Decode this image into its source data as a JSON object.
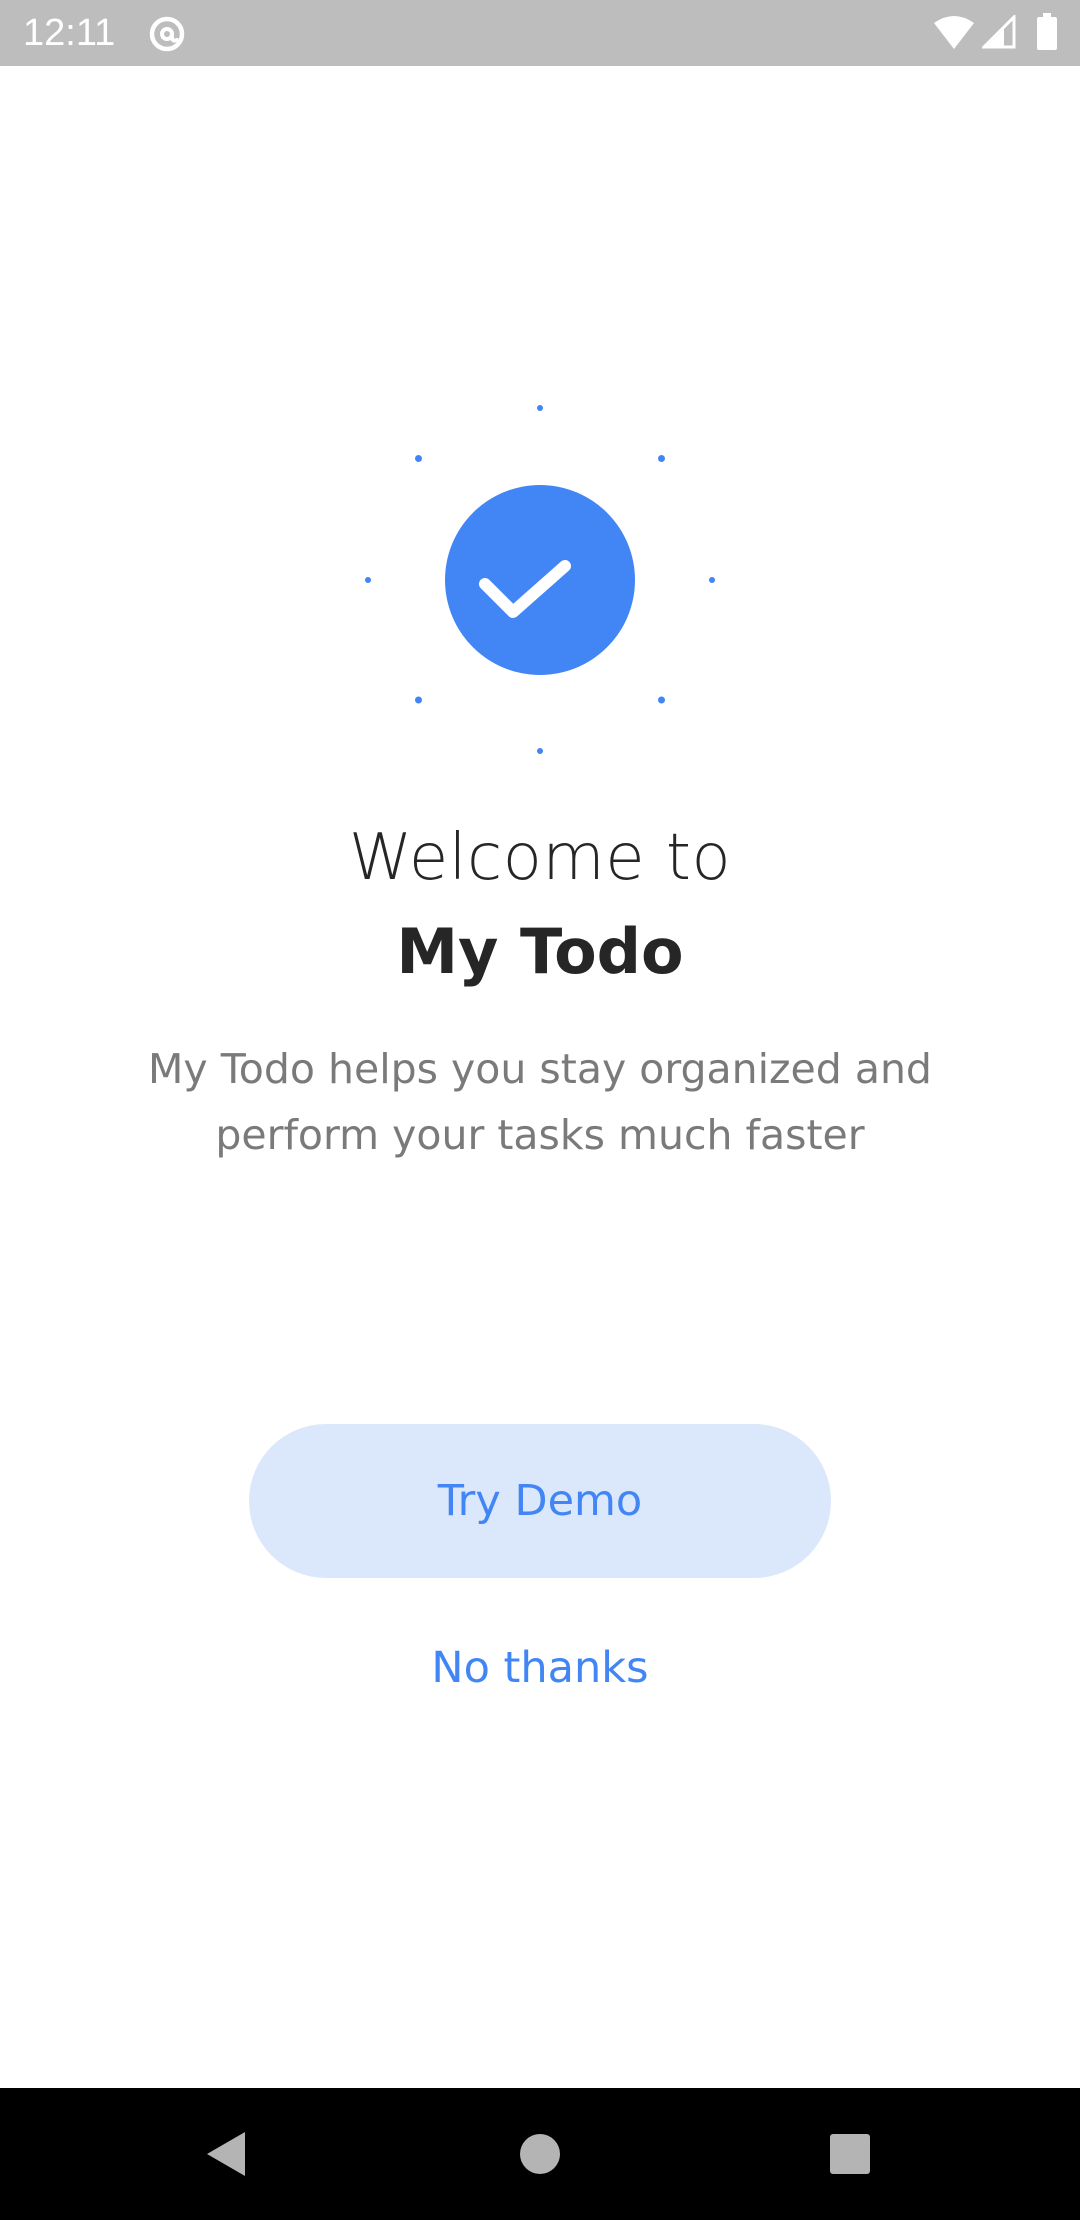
{
  "status_bar": {
    "time": "12:11",
    "icons": [
      "at-sign-icon",
      "wifi-icon",
      "cellular-signal-icon",
      "battery-icon"
    ]
  },
  "hero": {
    "icon": "checkmark-icon",
    "accent_color": "#4285f4"
  },
  "welcome": {
    "line1": "Welcome to",
    "line2": "My Todo"
  },
  "tagline": "My Todo helps you stay organized and perform your tasks much faster",
  "actions": {
    "primary_label": "Try Demo",
    "secondary_label": "No thanks",
    "primary_bg_color": "#dbe7fb",
    "primary_text_color": "#4285f4"
  },
  "nav_bar": {
    "icons": [
      "back-icon",
      "home-icon",
      "recents-icon"
    ]
  }
}
